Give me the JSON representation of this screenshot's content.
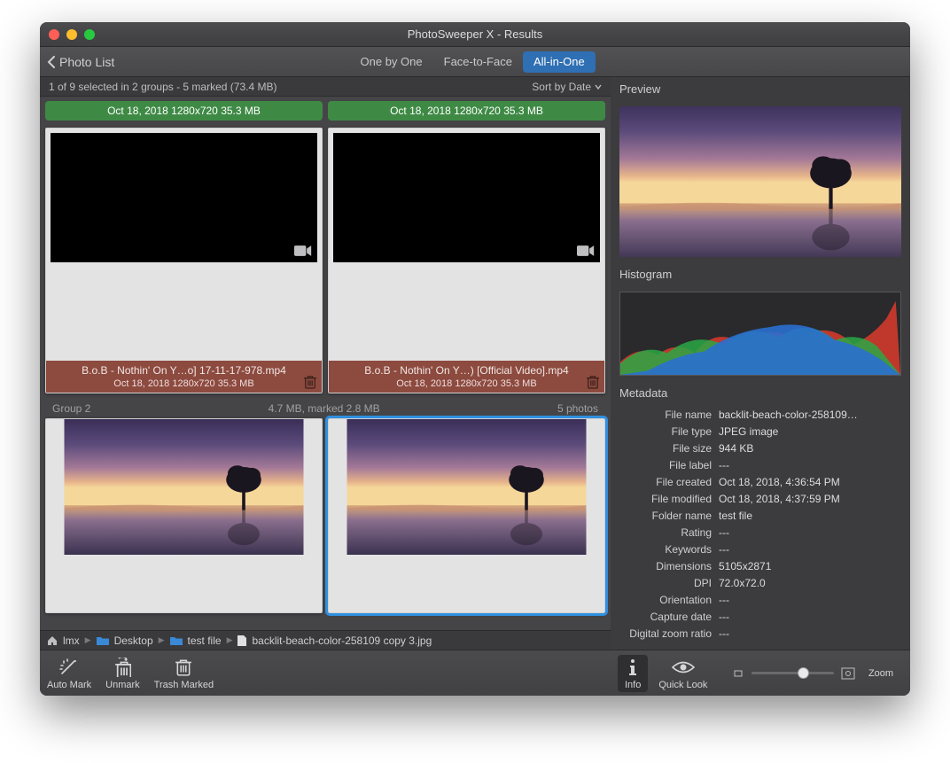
{
  "window_title": "PhotoSweeper X - Results",
  "back_label": "Photo List",
  "tabs": {
    "one": "One by One",
    "face": "Face-to-Face",
    "all": "All-in-One"
  },
  "status_text": "1 of 9 selected in 2 groups - 5 marked (73.4 MB)",
  "sort_label": "Sort by Date",
  "greenbars": {
    "a": "Oct 18, 2018  1280x720  35.3 MB",
    "b": "Oct 18, 2018  1280x720  35.3 MB"
  },
  "cards": {
    "c1": {
      "title": "B.o.B - Nothin' On Y…o] 17-11-17-978.mp4",
      "sub": "Oct 18, 2018  1280x720  35.3 MB"
    },
    "c2": {
      "title": "B.o.B - Nothin' On Y…) [Official Video].mp4",
      "sub": "Oct 18, 2018  1280x720  35.3 MB"
    }
  },
  "group2": {
    "name": "Group 2",
    "size": "4.7 MB, marked 2.8 MB",
    "count": "5 photos"
  },
  "breadcrumb": {
    "user": "lmx",
    "desktop": "Desktop",
    "folder": "test file",
    "file": "backlit-beach-color-258109 copy 3.jpg"
  },
  "tools": {
    "automark": "Auto Mark",
    "unmark": "Unmark",
    "trash": "Trash Marked",
    "info": "Info",
    "quicklook": "Quick Look",
    "zoom": "Zoom"
  },
  "right_headers": {
    "preview": "Preview",
    "histogram": "Histogram",
    "metadata": "Metadata"
  },
  "metadata": {
    "file_name": {
      "lab": "File name",
      "val": "backlit-beach-color-258109…"
    },
    "file_type": {
      "lab": "File type",
      "val": "JPEG image"
    },
    "file_size": {
      "lab": "File size",
      "val": "944 KB"
    },
    "file_label": {
      "lab": "File label",
      "val": "---"
    },
    "file_created": {
      "lab": "File created",
      "val": "Oct 18, 2018, 4:36:54 PM"
    },
    "file_modified": {
      "lab": "File modified",
      "val": "Oct 18, 2018, 4:37:59 PM"
    },
    "folder_name": {
      "lab": "Folder name",
      "val": "test file"
    },
    "rating": {
      "lab": "Rating",
      "val": "---"
    },
    "keywords": {
      "lab": "Keywords",
      "val": "---"
    },
    "dimensions": {
      "lab": "Dimensions",
      "val": "5105x2871"
    },
    "dpi": {
      "lab": "DPI",
      "val": "72.0x72.0"
    },
    "orientation": {
      "lab": "Orientation",
      "val": "---"
    },
    "capture_date": {
      "lab": "Capture date",
      "val": "---"
    },
    "digital_zoom": {
      "lab": "Digital zoom ratio",
      "val": "---"
    }
  }
}
